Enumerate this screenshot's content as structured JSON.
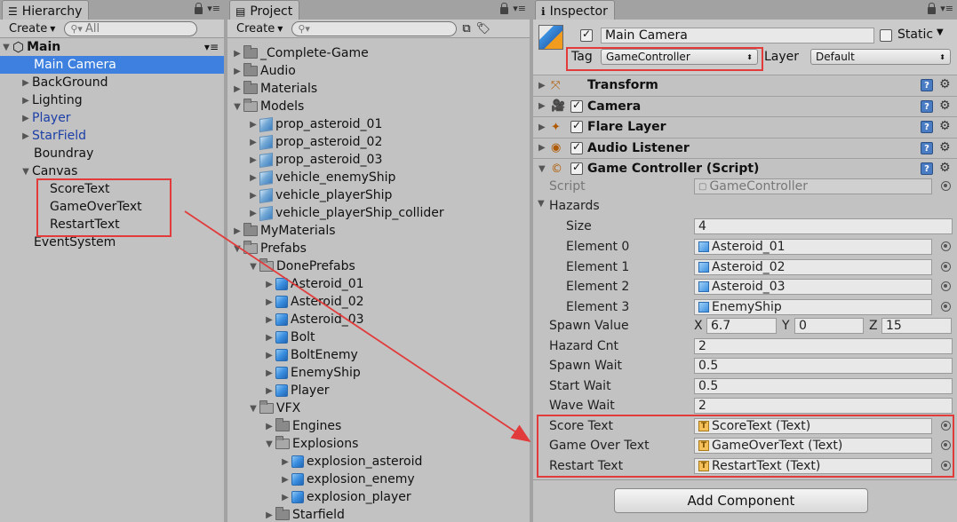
{
  "hierarchy": {
    "tab": "Hierarchy",
    "create": "Create",
    "search_placeholder": "All",
    "scene": "Main",
    "items": [
      "Main Camera",
      "BackGround",
      "Lighting",
      "Player",
      "StarField",
      "Boundray",
      "Canvas",
      "ScoreText",
      "GameOverText",
      "RestartText",
      "EventSystem"
    ]
  },
  "project": {
    "tab": "Project",
    "create": "Create",
    "items": [
      "_Complete-Game",
      "Audio",
      "Materials",
      "Models",
      "prop_asteroid_01",
      "prop_asteroid_02",
      "prop_asteroid_03",
      "vehicle_enemyShip",
      "vehicle_playerShip",
      "vehicle_playerShip_collider",
      "MyMaterials",
      "Prefabs",
      "DonePrefabs",
      "Asteroid_01",
      "Asteroid_02",
      "Asteroid_03",
      "Bolt",
      "BoltEnemy",
      "EnemyShip",
      "Player",
      "VFX",
      "Engines",
      "Explosions",
      "explosion_asteroid",
      "explosion_enemy",
      "explosion_player",
      "Starfield"
    ]
  },
  "inspector": {
    "tab": "Inspector",
    "object_name": "Main Camera",
    "static_label": "Static",
    "tag_label": "Tag",
    "tag_value": "GameController",
    "layer_label": "Layer",
    "layer_value": "Default",
    "components": [
      "Transform",
      "Camera",
      "Flare Layer",
      "Audio Listener",
      "Game Controller (Script)"
    ],
    "script_label": "Script",
    "script_value": "GameController",
    "hazards_label": "Hazards",
    "size_label": "Size",
    "size_value": "4",
    "elements": [
      {
        "label": "Element 0",
        "value": "Asteroid_01"
      },
      {
        "label": "Element 1",
        "value": "Asteroid_02"
      },
      {
        "label": "Element 2",
        "value": "Asteroid_03"
      },
      {
        "label": "Element 3",
        "value": "EnemyShip"
      }
    ],
    "spawn_value_label": "Spawn Value",
    "spawn_x": "6.7",
    "spawn_y": "0",
    "spawn_z": "15",
    "x_label": "X",
    "y_label": "Y",
    "z_label": "Z",
    "hazard_cnt_label": "Hazard Cnt",
    "hazard_cnt_value": "2",
    "spawn_wait_label": "Spawn Wait",
    "spawn_wait_value": "0.5",
    "start_wait_label": "Start Wait",
    "start_wait_value": "0.5",
    "wave_wait_label": "Wave Wait",
    "wave_wait_value": "2",
    "score_text_label": "Score Text",
    "score_text_value": "ScoreText (Text)",
    "game_over_label": "Game Over Text",
    "game_over_value": "GameOverText (Text)",
    "restart_label": "Restart Text",
    "restart_value": "RestartText (Text)",
    "add_component": "Add Component"
  },
  "colors": {
    "selection": "#3d80df",
    "annotation": "#e23b3b",
    "prefab_text": "#1c3fa8"
  }
}
